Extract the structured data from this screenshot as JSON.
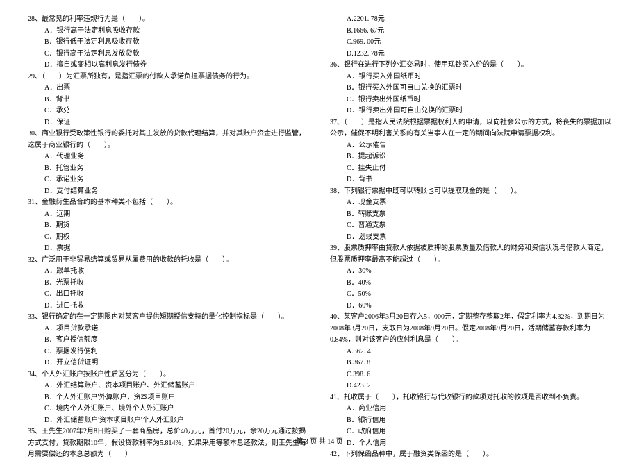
{
  "left": {
    "q28": {
      "text": "28、最常见的利率违规行为是（　　）。",
      "A": "A．银行高于法定利息吸收存款",
      "B": "B．银行低于法定利息吸收存款",
      "C": "C．银行高于法定利息发放贷款",
      "D": "D．擅自或变相以高利息发行债券"
    },
    "q29": {
      "text": "29、（　　）为汇票所独有，是指汇票的付款人承诺负担票据债务的行为。",
      "A": "A．出票",
      "B": "B．背书",
      "C": "C．承兑",
      "D": "D．保证"
    },
    "q30": {
      "text": "30、商业银行受政策性银行的委托对其主发放的贷款代理结算，并对其账户资金进行监管，这属于商业银行的（　　）。",
      "A": "A．代理业务",
      "B": "B．托管业务",
      "C": "C．承诺业务",
      "D": "D．支付结算业务"
    },
    "q31": {
      "text": "31、金融衍生品合约的基本种类不包括（　　）。",
      "A": "A．远期",
      "B": "B．期货",
      "C": "C．期权",
      "D": "D．票据"
    },
    "q32": {
      "text": "32、广泛用于非贸易结算或贸易从属费用的收款的托收是（　　）。",
      "A": "A．跟单托收",
      "B": "B．光票托收",
      "C": "C．出口托收",
      "D": "D．进口托收"
    },
    "q33": {
      "text": "33、银行确定的在一定期限内对某客户提供短期授信支持的量化控制指标是（　　）。",
      "A": "A．项目贷款承诺",
      "B": "B．客户授信额度",
      "C": "C．票据发行便利",
      "D": "D．开立信贷证明"
    },
    "q34": {
      "text": "34、个人外汇账户按账户性质区分为（　　）。",
      "A": "A．外汇结算账户、资本项目账户、外汇储蓄账户",
      "B": "B．个人外汇账户'外算账户，资本项目账户",
      "C": "C．境内个人外汇账户、境外个人外汇账户",
      "D": "D．外汇储蓄账户'资本项目账户'个人外汇账户"
    },
    "q35": {
      "text": "35、王先生2007年2月8日购买了一套商品房，总价40万元，首付20万元，余20万元通过按揭方式支付，贷款期限10年，假设贷款利率为5.814%，如果采用等额本息还款法，则王先生每月需要偿还的本息总额为（　　）"
    }
  },
  "right": {
    "q35opts": {
      "A": "A.2201. 78元",
      "B": "B.1666. 67元",
      "C": "C.969. 00元",
      "D": "D.1232. 78元"
    },
    "q36": {
      "text": "36、银行在进行下列外汇交易时，使用现钞买入价的是（　　）。",
      "A": "A．银行买入外国纸币时",
      "B": "B．银行买入外国可自由兑换的汇票时",
      "C": "C．银行卖出外国纸币时",
      "D": "D．银行卖出外国可自由兑换的汇票时"
    },
    "q37": {
      "text": "37、（　　）是指人民法院根据票据权利人的申请，以向社会公示的方式，将丧失的票据加以公示，催促不明利害关系的有关当事人在一定的期间向法院申请票据权利。",
      "A": "A．公示催告",
      "B": "B．提起诉讼",
      "C": "C．挂失止付",
      "D": "D．背书"
    },
    "q38": {
      "text": "38、下列银行票据中既可以转账也可以提取现金的是（　　）。",
      "A": "A．现金支票",
      "B": "B．转账支票",
      "C": "C．普通支票",
      "D": "D．划线支票"
    },
    "q39": {
      "text": "39、股票质押率由贷款人依据被质押的股票质量及借款人的财务和资信状况与借款人商定，但股票质押率最高不能超过（　　）。",
      "A": "A．30%",
      "B": "B．40%",
      "C": "C．50%",
      "D": "D．60%"
    },
    "q40": {
      "text": "40、某客户2006年3月20日存入5，000元，定期整存整取2年，假定利率为4.32%，到期日为2008年3月20日，支取日为2008年9月20日。假定2008年9月20日，活期储蓄存款利率为0.84%，则对该客户的应付利息是（　　）。",
      "A": "A.362. 4",
      "B": "B.367. 8",
      "C": "C.398. 6",
      "D": "D.423. 2"
    },
    "q41": {
      "text": "41、托收属于（　　），托收银行与代收银行的款项对托收的款项是否收到不负责。",
      "A": "A．商业信用",
      "B": "B．银行信用",
      "C": "C．政府信用",
      "D": "D．个人信用"
    },
    "q42": {
      "text": "42、下列保函品种中，属于融资类保函的是（　　）。"
    }
  },
  "footer": "第 3 页 共 14 页"
}
